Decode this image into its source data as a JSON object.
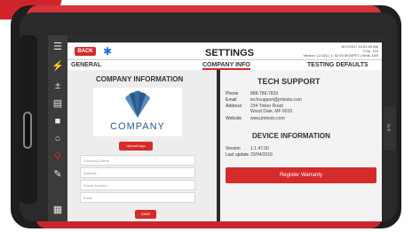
{
  "statusbar": {
    "left": "",
    "right": ""
  },
  "header": {
    "back_label": "BACK",
    "title": "SETTINGS",
    "version_line1": "8/17/2017 10:51:50 AM",
    "version_line2": "V No. 115",
    "version_line3": "Version 1.2.421 | 1: 02:00 MOSFET | Work 15/0"
  },
  "tabs": [
    {
      "label": "GENERAL"
    },
    {
      "label": "COMPANY INFO"
    },
    {
      "label": "TESTING DEFAULTS"
    }
  ],
  "company": {
    "section_title": "COMPANY INFORMATION",
    "logo_text": "COMPANY",
    "upload_label": "Upload logo",
    "fields": [
      {
        "placeholder": "Company Name"
      },
      {
        "placeholder": "Address"
      },
      {
        "placeholder": "Phone Number"
      },
      {
        "placeholder": "Email"
      }
    ],
    "save_label": "SAVE"
  },
  "support": {
    "section_title": "TECH SUPPORT",
    "phone_label": "Phone",
    "phone": "888-786-7839",
    "email_label": "Email",
    "email": "techsupport@jmtools.com",
    "address_label": "Address",
    "address_line1": "234 Tinker Road",
    "address_line2": "Wood Dale, MF 6010",
    "website_label": "Website",
    "website": "www.jmtools.com"
  },
  "device": {
    "section_title": "DEVICE INFORMATION",
    "version_label": "Version",
    "version": "1.1.47.00",
    "lastupdate_label": "Last update",
    "lastupdate": "20/04/2016"
  },
  "warranty_label": "Register Warranty",
  "side_tab_text": "fs-fi",
  "colors": {
    "accent": "#d62b2b",
    "bumper": "#d0242b",
    "bluetooth": "#1c70d8"
  }
}
